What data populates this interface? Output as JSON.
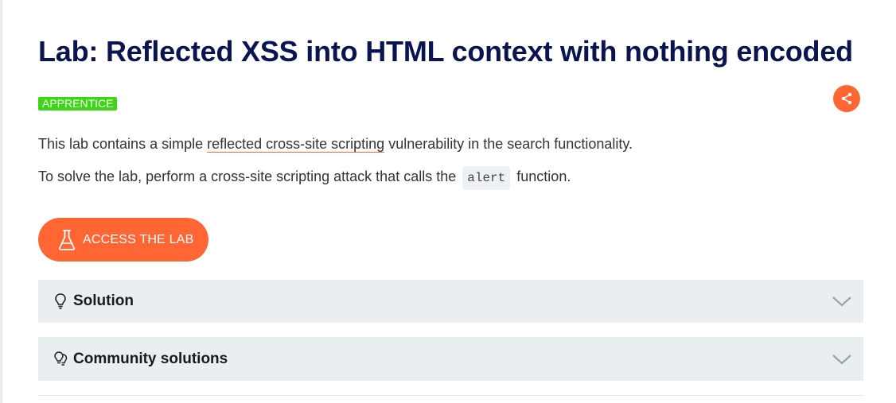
{
  "lab": {
    "title": "Lab: Reflected XSS into HTML context with nothing encoded",
    "level": "APPRENTICE"
  },
  "description": {
    "line1_before": "This lab contains a simple ",
    "line1_link": "reflected cross-site scripting",
    "line1_after": " vulnerability in the search functionality.",
    "line2_before": "To solve the lab, perform a cross-site scripting attack that calls the",
    "line2_code": "alert",
    "line2_after": "function."
  },
  "actions": {
    "access_label": "ACCESS THE LAB"
  },
  "accordions": [
    {
      "label": "Solution",
      "icon": "lightbulb-icon"
    },
    {
      "label": "Community solutions",
      "icon": "community-lightbulbs-icon"
    }
  ],
  "colors": {
    "title": "#0a1450",
    "badge": "#3bd614",
    "accent": "#ff6633",
    "accordion_bg": "#e9eef1"
  }
}
